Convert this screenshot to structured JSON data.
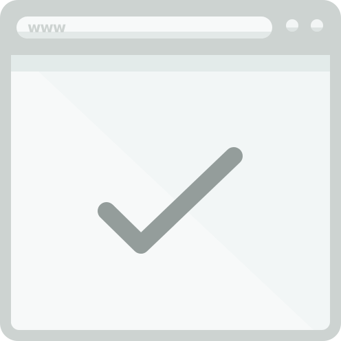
{
  "browser": {
    "address_bar": {
      "text": "www"
    },
    "window_controls": [
      "dot",
      "dot"
    ],
    "content": {
      "icon": "checkmark-icon"
    }
  },
  "colors": {
    "frame": "#cdd3d1",
    "content_light": "#f2f6f6",
    "content_shade": "#ffffff",
    "checkmark": "#949d9b"
  }
}
